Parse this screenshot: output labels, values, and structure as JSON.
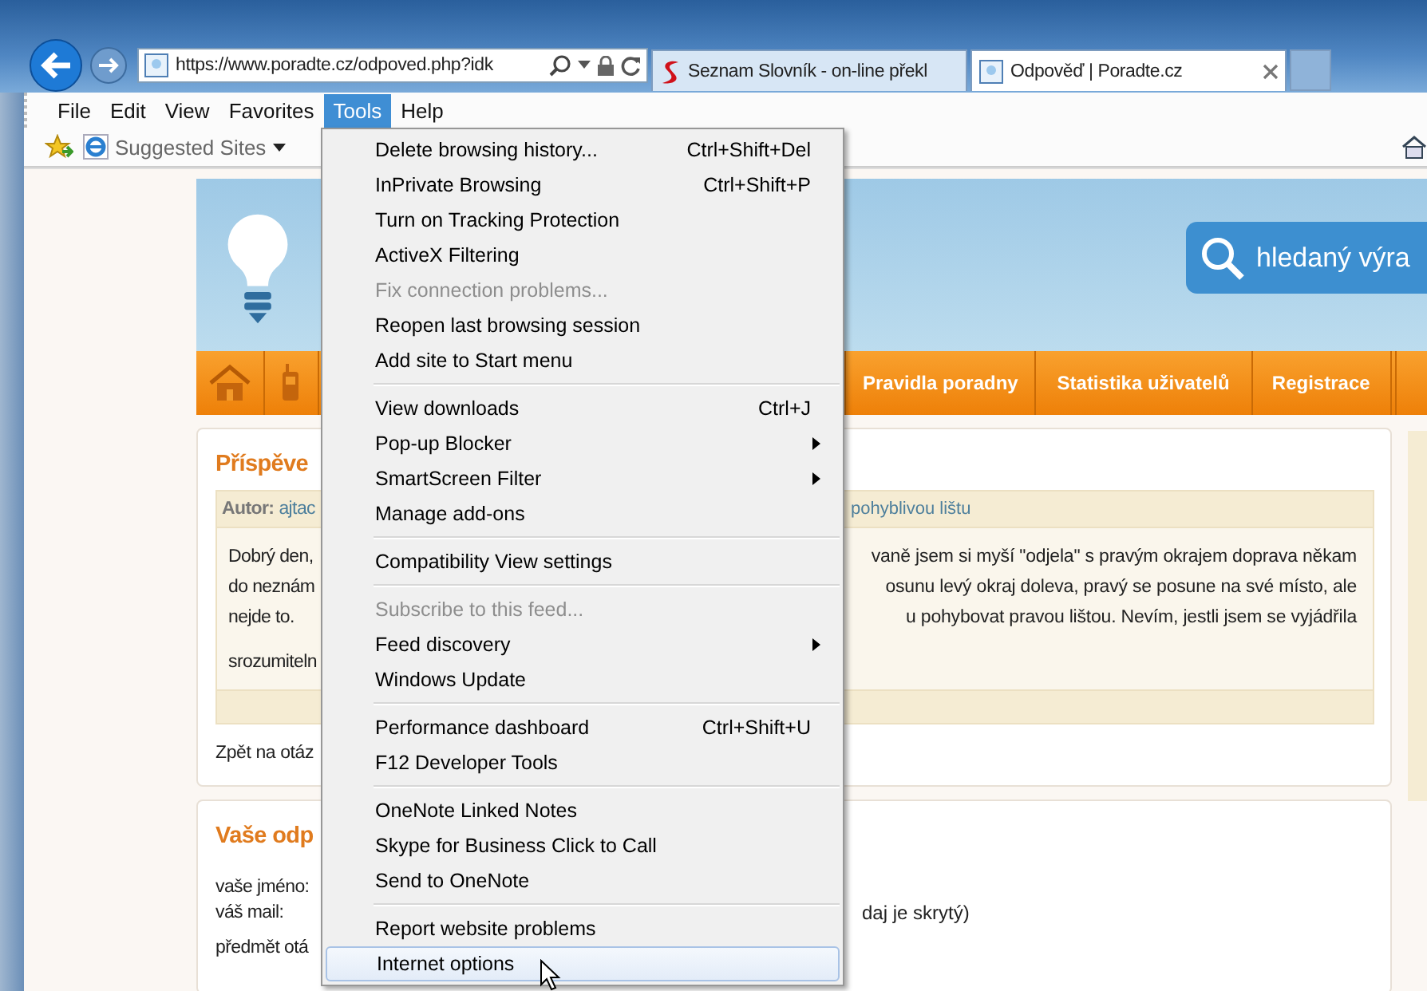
{
  "address_bar": {
    "url": "https://www.poradte.cz/odpoved.php?idk"
  },
  "tabs": [
    {
      "label": "Seznam Slovník - on-line překl",
      "selected": false,
      "kind": "seznam"
    },
    {
      "label": "Odpověď | Poradte.cz",
      "selected": true,
      "kind": "page"
    }
  ],
  "menu_bar": [
    {
      "label": "File",
      "selected": false
    },
    {
      "label": "Edit",
      "selected": false
    },
    {
      "label": "View",
      "selected": false
    },
    {
      "label": "Favorites",
      "selected": false
    },
    {
      "label": "Tools",
      "selected": true
    },
    {
      "label": "Help",
      "selected": false
    }
  ],
  "favorites_bar": {
    "suggested": "Suggested Sites"
  },
  "tools_menu": [
    [
      {
        "label": "Delete browsing history...",
        "shortcut": "Ctrl+Shift+Del",
        "disabled": false,
        "submenu": false,
        "highlighted": false
      },
      {
        "label": "InPrivate Browsing",
        "shortcut": "Ctrl+Shift+P",
        "disabled": false,
        "submenu": false,
        "highlighted": false
      },
      {
        "label": "Turn on Tracking Protection",
        "disabled": false,
        "submenu": false,
        "highlighted": false
      },
      {
        "label": "ActiveX Filtering",
        "disabled": false,
        "submenu": false,
        "highlighted": false
      },
      {
        "label": "Fix connection problems...",
        "disabled": true,
        "submenu": false,
        "highlighted": false
      },
      {
        "label": "Reopen last browsing session",
        "disabled": false,
        "submenu": false,
        "highlighted": false
      },
      {
        "label": "Add site to Start menu",
        "disabled": false,
        "submenu": false,
        "highlighted": false
      }
    ],
    [
      {
        "label": "View downloads",
        "shortcut": "Ctrl+J",
        "disabled": false,
        "submenu": false,
        "highlighted": false
      },
      {
        "label": "Pop-up Blocker",
        "disabled": false,
        "submenu": true,
        "highlighted": false
      },
      {
        "label": "SmartScreen Filter",
        "disabled": false,
        "submenu": true,
        "highlighted": false
      },
      {
        "label": "Manage add-ons",
        "disabled": false,
        "submenu": false,
        "highlighted": false
      }
    ],
    [
      {
        "label": "Compatibility View settings",
        "disabled": false,
        "submenu": false,
        "highlighted": false
      }
    ],
    [
      {
        "label": "Subscribe to this feed...",
        "disabled": true,
        "submenu": false,
        "highlighted": false
      },
      {
        "label": "Feed discovery",
        "disabled": false,
        "submenu": true,
        "highlighted": false
      },
      {
        "label": "Windows Update",
        "disabled": false,
        "submenu": false,
        "highlighted": false
      }
    ],
    [
      {
        "label": "Performance dashboard",
        "shortcut": "Ctrl+Shift+U",
        "disabled": false,
        "submenu": false,
        "highlighted": false
      },
      {
        "label": "F12 Developer Tools",
        "disabled": false,
        "submenu": false,
        "highlighted": false
      }
    ],
    [
      {
        "label": "OneNote Linked Notes",
        "disabled": false,
        "submenu": false,
        "highlighted": false
      },
      {
        "label": "Skype for Business Click to Call",
        "disabled": false,
        "submenu": false,
        "highlighted": false
      },
      {
        "label": "Send to OneNote",
        "disabled": false,
        "submenu": false,
        "highlighted": false
      }
    ],
    [
      {
        "label": "Report website problems",
        "disabled": false,
        "submenu": false,
        "highlighted": false
      },
      {
        "label": "Internet options",
        "disabled": false,
        "submenu": false,
        "highlighted": true
      }
    ]
  ],
  "site": {
    "search": {
      "placeholder": "hledaný výra"
    },
    "nav": [
      "Pravidla poradny",
      "Statistika uživatelů",
      "Registrace"
    ],
    "post": {
      "title": "Příspěve",
      "author_label": "Autor:",
      "author": "ajtac",
      "subject_tail": "pohyblivou lištu",
      "lines": [
        {
          "left": "Dobrý den,",
          "right": "vaně jsem si myší \"odjela\" s pravým okrajem doprava někam"
        },
        {
          "left": "do neznám",
          "right": "osunu levý okraj doleva, pravý se posune na své místo, ale"
        },
        {
          "left": "nejde to.",
          "right": "u pohybovat pravou lištou. Nevím, jestli jsem se vyjádřila"
        },
        {
          "left": "srozumiteln"
        }
      ],
      "back_link": "Zpět na otáz"
    },
    "reply": {
      "title": "Vaše odp",
      "rows": [
        {
          "left": "vaše jméno:"
        },
        {
          "left": "váš mail:",
          "right": "daj je skrytý)"
        },
        {
          "left": "předmět otá"
        }
      ]
    }
  }
}
